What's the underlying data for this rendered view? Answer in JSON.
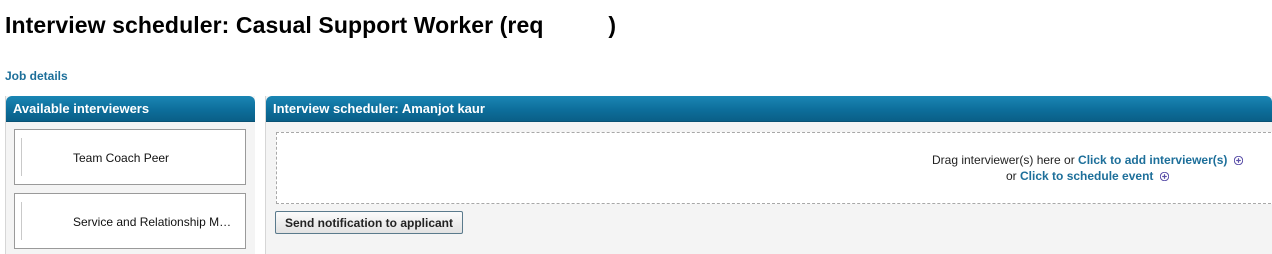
{
  "header": {
    "title": "Interview scheduler: Casual Support Worker (req          )"
  },
  "links": {
    "job_details": "Job details"
  },
  "available_panel": {
    "title": "Available interviewers",
    "interviewers": [
      {
        "name": "Team Coach Peer"
      },
      {
        "name": "Service and Relationship Manager"
      }
    ]
  },
  "scheduler_panel": {
    "title": "Interview scheduler: Amanjot kaur",
    "drop_text": "Drag interviewer(s) here or ",
    "add_link": "Click to add interviewer(s)",
    "or_text": "or ",
    "schedule_link": "Click to schedule event",
    "notify_button": "Send notification to applicant"
  },
  "colors": {
    "header_blue": "#0d6e9b",
    "link_blue": "#1d6f9a",
    "plus_icon": "#5a4fa8"
  }
}
